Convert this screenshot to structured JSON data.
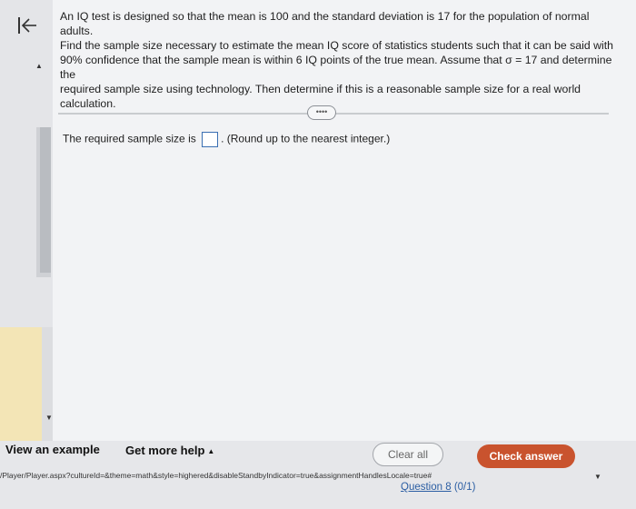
{
  "question": {
    "lines": [
      "An IQ test is designed so that the mean is 100 and the standard deviation is 17 for the population of normal adults.",
      "Find the sample size necessary to estimate the mean IQ score of statistics students such that it can be said with",
      "90% confidence that the sample mean is within 6 IQ points of the true mean. Assume that σ = 17 and determine the",
      "required sample size using technology. Then determine if this is a reasonable sample size for a real world calculation."
    ]
  },
  "more_button_label": "••••",
  "answer": {
    "prefix": "The required sample size is",
    "value": "",
    "suffix": ". (Round up to the nearest integer.)"
  },
  "footer": {
    "view_example": "View an example",
    "get_help": "Get more help",
    "get_help_caret": "▲",
    "clear_all": "Clear all",
    "check_answer": "Check answer",
    "url": "/Player/Player.aspx?cultureId=&theme=math&style=highered&disableStandbyIndicator=true&assignmentHandlesLocale=true#",
    "question_word": "Question 8",
    "question_progress": "(0/1)"
  },
  "icons": {
    "back": "collapse-left-icon",
    "up": "triangle-up-icon",
    "down": "triangle-down-icon"
  },
  "colors": {
    "accent": "#c9532e",
    "link": "#2b5ea3"
  }
}
